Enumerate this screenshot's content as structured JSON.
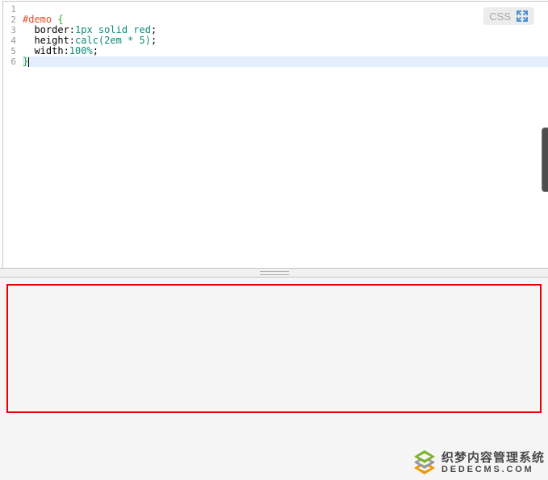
{
  "editor": {
    "badge": {
      "label": "CSS",
      "icon": "fullscreen-expand-icon",
      "icon_color": "#4a93d6"
    },
    "line_numbers": [
      "1",
      "2",
      "3",
      "4",
      "5",
      "6"
    ],
    "code": {
      "l2_selector": "#demo ",
      "l2_brace": "{",
      "l3_prop": "  border:",
      "l3_value": "1px solid red",
      "l3_semi": ";",
      "l4_prop": "  height:",
      "l4_value": "calc(2em * 5)",
      "l4_semi": ";",
      "l5_prop": "  width:",
      "l5_value": "100%",
      "l5_semi": ";",
      "l6_brace": "}"
    },
    "colors": {
      "selector": "#e0502a",
      "brace": "#2aa52a",
      "value": "#0d8a7a",
      "plain_text": "#000000",
      "line_number": "#999999",
      "active_line_bg": "#e3edfb"
    }
  },
  "preview": {
    "demo_box_border_color": "#e60000",
    "background": "#f5f5f6"
  },
  "watermark": {
    "title": "织梦内容管理系统",
    "domain": "DEDECMS.COM",
    "logo_colors": {
      "top": "#7cb42e",
      "middle": "#979797",
      "bottom": "#f09600"
    }
  }
}
